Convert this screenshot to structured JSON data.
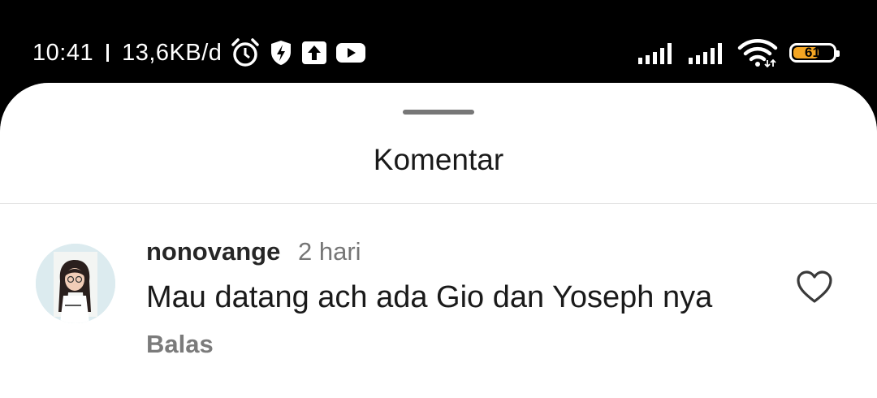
{
  "status_bar": {
    "time": "10:41",
    "network_speed": "13,6KB/d",
    "left_icons": [
      "alarm-icon",
      "shield-bolt-icon",
      "upload-icon",
      "youtube-icon"
    ],
    "right_icons": [
      "signal-icon",
      "signal-icon",
      "wifi-icon"
    ],
    "battery_level": "61",
    "battery_color": "#f5a623"
  },
  "sheet": {
    "title": "Komentar"
  },
  "comments": [
    {
      "username": "nonovange",
      "time": "2 hari",
      "text": "Mau datang ach ada Gio dan Yoseph nya",
      "reply_label": "Balas",
      "like_icon": "heart-outline-icon"
    }
  ]
}
